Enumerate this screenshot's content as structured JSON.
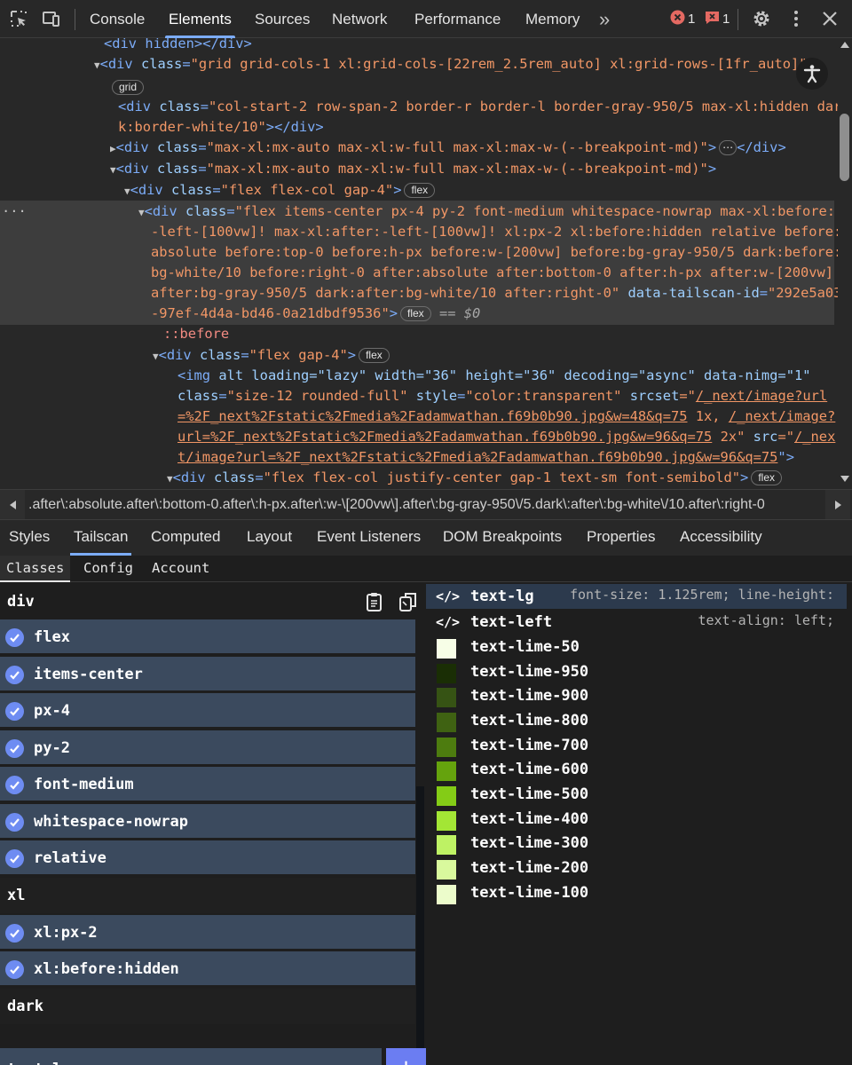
{
  "toolbar": {
    "tabs": [
      "Console",
      "Elements",
      "Sources",
      "Network",
      "Performance",
      "Memory"
    ],
    "active_tab": "Elements",
    "more": "»",
    "errors_count": "1",
    "issues_count": "1",
    "colors": {
      "accent": "#7cacf8",
      "error": "#e46962"
    }
  },
  "tree": {
    "l0": "<div hidden></div>",
    "l1a": "<div ",
    "l1n": "class",
    "l1v": "\"grid grid-cols-1 xl:grid-cols-[22rem_2.5rem_auto] xl:grid-rows-[1fr_auto]\"",
    "l2pill": "grid",
    "l3a": "<div ",
    "l3n": "class",
    "l3v": "\"col-start-2 row-span-2 border-r border-l border-gray-950/5 max-xl:hidden dar",
    "l4v": "k:border-white/10\"",
    "l4b": "></div>",
    "l5a": "<div ",
    "l5n": "class",
    "l5v": "\"max-xl:mx-auto max-xl:w-full max-xl:max-w-(--breakpoint-md)\"",
    "l5b": ">",
    "l5ell": "⋯",
    "l5c": "</div>",
    "l6a": "<div ",
    "l6n": "class",
    "l6v": "\"max-xl:mx-auto max-xl:w-full max-xl:max-w-(--breakpoint-md)\"",
    "l6b": ">",
    "l7a": "<div ",
    "l7n": "class",
    "l7v": "\"flex flex-col gap-4\"",
    "l7b": ">",
    "l7pill": "flex",
    "sel_dots": "···",
    "s1a": "<div ",
    "s1n": "class",
    "s1v": "\"flex items-center px-4 py-2 font-medium whitespace-nowrap max-xl:before:",
    "s2v": "-left-[100vw]! max-xl:after:-left-[100vw]! xl:px-2 xl:before:hidden relative before:",
    "s3v": "absolute before:top-0 before:h-px before:w-[200vw] before:bg-gray-950/5 dark:before:",
    "s4v": "bg-white/10 before:right-0 after:absolute after:bottom-0 after:h-px after:w-[200vw]",
    "s5v": "after:bg-gray-950/5 dark:after:bg-white/10 after:right-0\"",
    "s5n": "data-tailscan-id",
    "s5eq": "=",
    "s5v2": "\"292e5a03",
    "s6v": "-97ef-4d4a-bd46-0a21dbdf9536\"",
    "s6b": ">",
    "s6pill": "flex",
    "s6eq": "== $0",
    "before": "::before",
    "b1a": "<div ",
    "b1n": "class",
    "b1v": "\"flex gap-4\"",
    "b1b": ">",
    "b1pill": "flex",
    "i1": "<img ",
    "i1rest": "alt loading=\"lazy\" width=\"36\" height=\"36\" decoding=\"async\" data-nimg=\"1\"",
    "i2n": "class",
    "i2v": "\"size-12 rounded-full\"",
    "i2n2": "style",
    "i2v2": "\"color:transparent\"",
    "i2n3": "srcset",
    "i2q": "=\"",
    "i2l": "/_next/image?url",
    "i3l": "=%2F_next%2Fstatic%2Fmedia%2Fadamwathan.f69b0b90.jpg&w=48&q=75",
    "i3t": " 1x, ",
    "i3l2": "/_next/image?",
    "i4l": "url=%2F_next%2Fstatic%2Fmedia%2Fadamwathan.f69b0b90.jpg&w=96&q=75",
    "i4t": " 2x\" ",
    "i4n": "src",
    "i4q": "=\"",
    "i4l2": "/_nex",
    "i5l": "t/image?url=%2F_next%2Fstatic%2Fmedia%2Fadamwathan.f69b0b90.jpg&w=96&q=75",
    "i5b": "\">",
    "c1a": "<div ",
    "c1n": "class",
    "c1v": "\"flex flex-col justify-center gap-1 text-sm font-semibold\"",
    "c1b": ">",
    "c1pill": "flex"
  },
  "breadcrumb": ".after\\:absolute.after\\:bottom-0.after\\:h-px.after\\:w-\\[200vw\\].after\\:bg-gray-950\\/5.dark\\:after\\:bg-white\\/10.after\\:right-0",
  "subtabs": [
    "Styles",
    "Tailscan",
    "Computed",
    "Layout",
    "Event Listeners",
    "DOM Breakpoints",
    "Properties",
    "Accessibility"
  ],
  "active_subtab": "Tailscan",
  "tailscan": {
    "tabs": [
      "Classes",
      "Config",
      "Account"
    ],
    "groups": {
      "div": {
        "title": "div",
        "classes": [
          "flex",
          "items-center",
          "px-4",
          "py-2",
          "font-medium",
          "whitespace-nowrap",
          "relative"
        ]
      },
      "xl": {
        "title": "xl",
        "classes": [
          "xl:px-2",
          "xl:before:hidden"
        ]
      },
      "dark": {
        "title": "dark"
      }
    },
    "input_value": "text-l",
    "add_label": "+",
    "suggestions": [
      {
        "name": "text-lg",
        "desc": "font-size: 1.125rem; line-height:",
        "icon": "code-icon"
      },
      {
        "name": "text-left",
        "desc": "text-align: left;",
        "icon": "code-icon"
      },
      {
        "name": "text-lime-50",
        "color": "#f7fee7"
      },
      {
        "name": "text-lime-950",
        "color": "#1a2e05"
      },
      {
        "name": "text-lime-900",
        "color": "#365314"
      },
      {
        "name": "text-lime-800",
        "color": "#3f6212"
      },
      {
        "name": "text-lime-700",
        "color": "#4d7c0f"
      },
      {
        "name": "text-lime-600",
        "color": "#65a30d"
      },
      {
        "name": "text-lime-500",
        "color": "#84cc16"
      },
      {
        "name": "text-lime-400",
        "color": "#a3e635"
      },
      {
        "name": "text-lime-300",
        "color": "#bef264"
      },
      {
        "name": "text-lime-200",
        "color": "#d9f99d"
      },
      {
        "name": "text-lime-100",
        "color": "#ecfccb"
      }
    ]
  }
}
